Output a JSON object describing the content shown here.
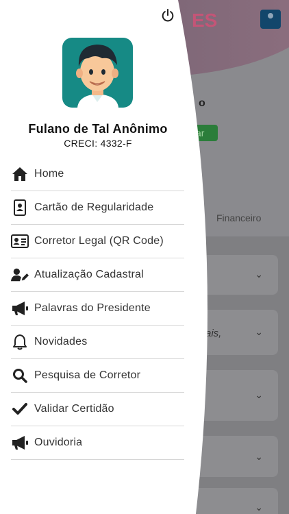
{
  "user": {
    "name": "Fulano de Tal Anônimo",
    "creci": "CRECI: 4332-F"
  },
  "menu": [
    {
      "label": "Home",
      "icon": "home-icon"
    },
    {
      "label": "Cartão de Regularidade",
      "icon": "id-badge-icon"
    },
    {
      "label": "Corretor Legal (QR Code)",
      "icon": "id-card-icon"
    },
    {
      "label": "Atualização Cadastral",
      "icon": "user-edit-icon"
    },
    {
      "label": "Palavras do Presidente",
      "icon": "megaphone-icon"
    },
    {
      "label": "Novidades",
      "icon": "bell-icon"
    },
    {
      "label": "Pesquisa de Corretor",
      "icon": "search-icon"
    },
    {
      "label": "Validar Certidão",
      "icon": "checkmark-icon"
    },
    {
      "label": "Ouvidoria",
      "icon": "megaphone-icon"
    }
  ],
  "background": {
    "logo_fragment": "ES",
    "title_fragment": "o",
    "status_fragment": "ar",
    "tab": "Financeiro",
    "italic_fragment": "ais,"
  }
}
